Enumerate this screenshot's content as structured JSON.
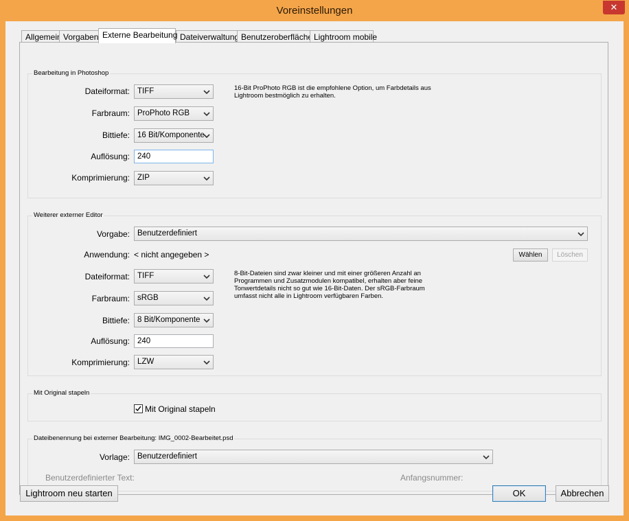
{
  "window": {
    "title": "Voreinstellungen",
    "close_glyph": "✕"
  },
  "tabs": [
    {
      "label": "Allgemein"
    },
    {
      "label": "Vorgaben"
    },
    {
      "label": "Externe Bearbeitung",
      "active": true
    },
    {
      "label": "Dateiverwaltung"
    },
    {
      "label": "Benutzeroberfläche"
    },
    {
      "label": "Lightroom mobile"
    }
  ],
  "photoshop": {
    "group_label": "Bearbeitung in Photoshop",
    "dateiformat_label": "Dateiformat:",
    "dateiformat_value": "TIFF",
    "farbraum_label": "Farbraum:",
    "farbraum_value": "ProPhoto RGB",
    "bittiefe_label": "Bittiefe:",
    "bittiefe_value": "16 Bit/Komponente",
    "aufloesung_label": "Auflösung:",
    "aufloesung_value": "240",
    "komprimierung_label": "Komprimierung:",
    "komprimierung_value": "ZIP",
    "note_line1": "16-Bit ProPhoto RGB ist die empfohlene Option, um Farbdetails aus",
    "note_line2": "Lightroom bestmöglich zu erhalten."
  },
  "external": {
    "group_label": "Weiterer externer Editor",
    "vorgabe_label": "Vorgabe:",
    "vorgabe_value": "Benutzerdefiniert",
    "anwendung_label": "Anwendung:",
    "anwendung_value": "< nicht angegeben >",
    "waehlen_label": "Wählen",
    "loeschen_label": "Löschen",
    "dateiformat_label": "Dateiformat:",
    "dateiformat_value": "TIFF",
    "farbraum_label": "Farbraum:",
    "farbraum_value": "sRGB",
    "bittiefe_label": "Bittiefe:",
    "bittiefe_value": "8 Bit/Komponente",
    "aufloesung_label": "Auflösung:",
    "aufloesung_value": "240",
    "komprimierung_label": "Komprimierung:",
    "komprimierung_value": "LZW",
    "note_line1": "8-Bit-Dateien sind zwar kleiner und mit einer größeren Anzahl an",
    "note_line2": "Programmen und Zusatzmodulen kompatibel, erhalten aber feine",
    "note_line3": "Tonwertdetails nicht so gut wie 16-Bit-Daten. Der sRGB-Farbraum",
    "note_line4": "umfasst nicht alle in Lightroom verfügbaren Farben."
  },
  "stack": {
    "group_label": "Mit Original stapeln",
    "checkbox_label": "Mit Original stapeln",
    "checked": true
  },
  "naming": {
    "group_label": "Dateibenennung bei externer Bearbeitung: IMG_0002-Bearbeitet.psd",
    "vorlage_label": "Vorlage:",
    "vorlage_value": "Benutzerdefiniert",
    "custom_text_label": "Benutzerdefinierter Text:",
    "start_number_label": "Anfangsnummer:"
  },
  "footer": {
    "restart_label": "Lightroom neu starten",
    "ok_label": "OK",
    "cancel_label": "Abbrechen"
  },
  "colors": {
    "titlebar": "#f4a54a",
    "close": "#c7372f",
    "dialog_bg": "#f0f0f0",
    "focus_border": "#7eb4ea"
  }
}
